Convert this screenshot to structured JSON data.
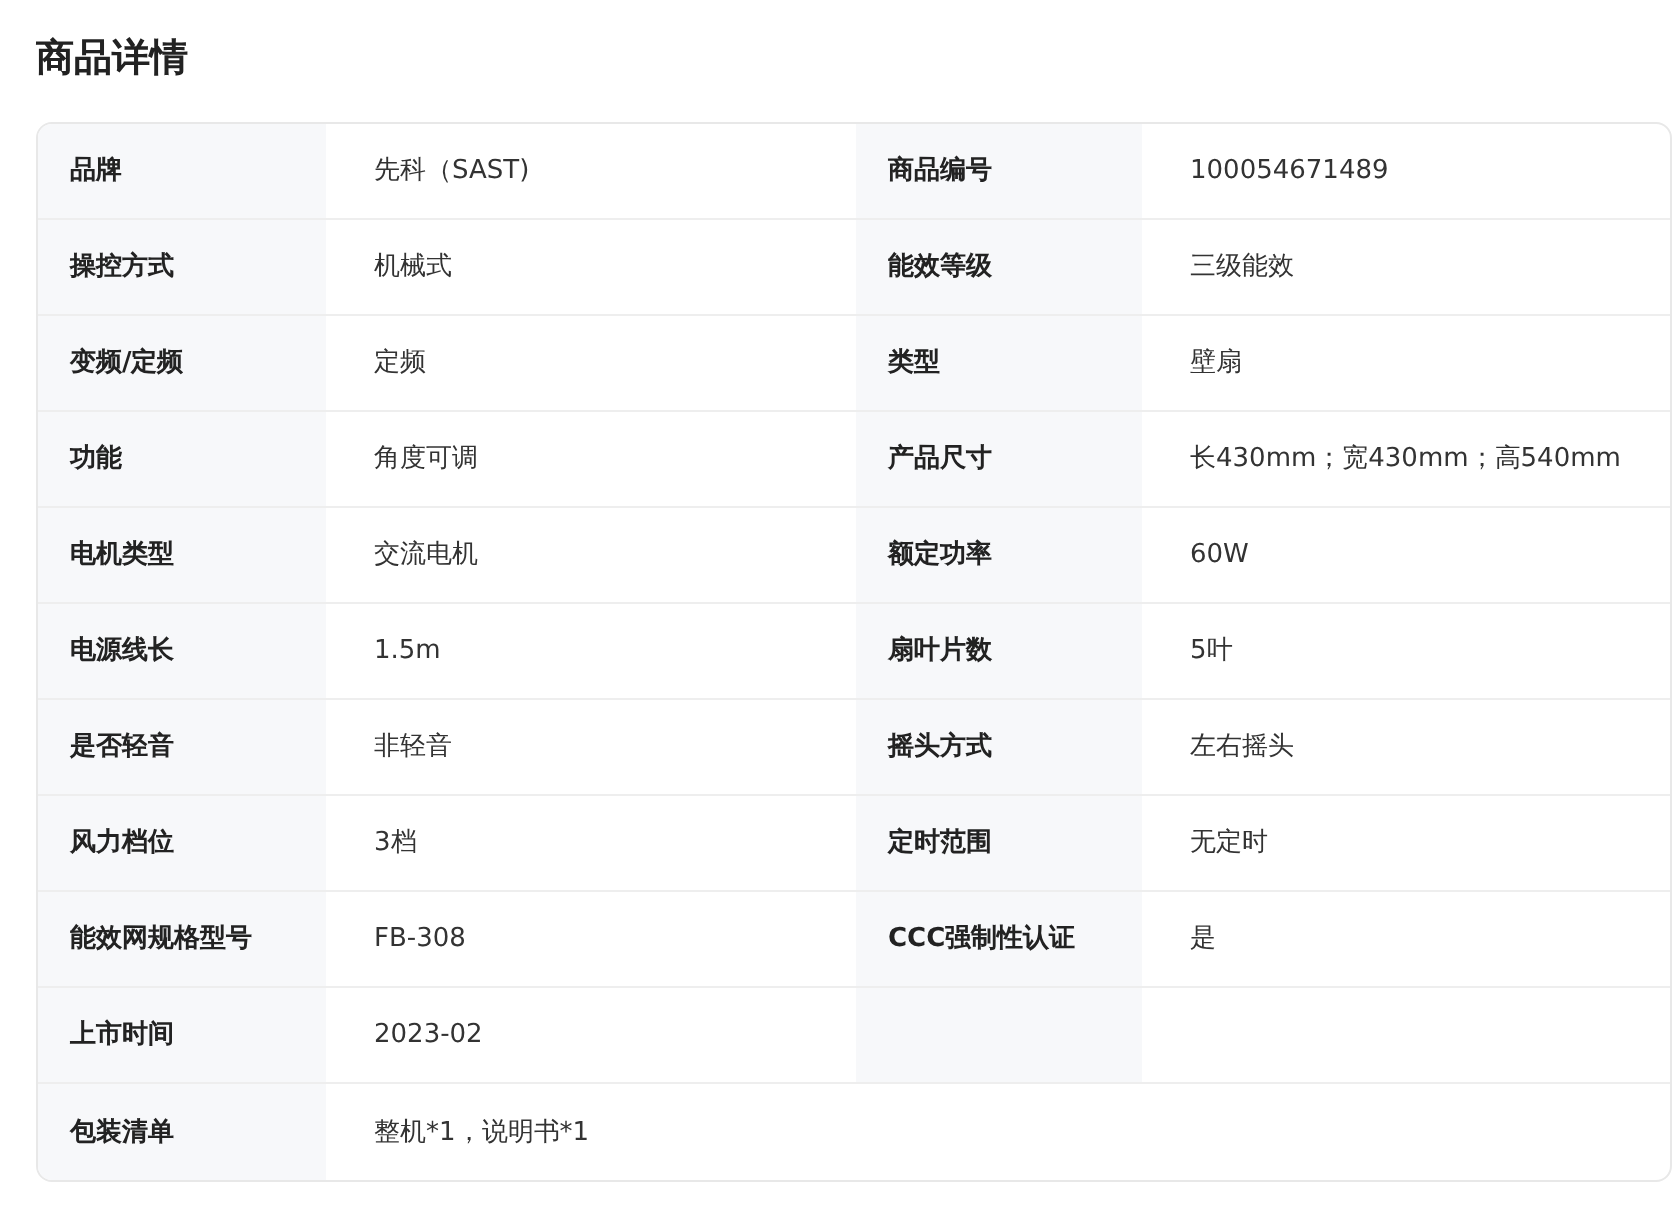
{
  "title": "商品详情",
  "rows": [
    {
      "kind": "pair",
      "fields": [
        {
          "label": "品牌",
          "value": "先科（SAST)"
        },
        {
          "label": "商品编号",
          "value": "100054671489"
        }
      ]
    },
    {
      "kind": "pair",
      "fields": [
        {
          "label": "操控方式",
          "value": "机械式"
        },
        {
          "label": "能效等级",
          "value": "三级能效"
        }
      ]
    },
    {
      "kind": "pair",
      "fields": [
        {
          "label": "变频/定频",
          "value": "定频"
        },
        {
          "label": "类型",
          "value": "壁扇"
        }
      ]
    },
    {
      "kind": "pair",
      "fields": [
        {
          "label": "功能",
          "value": "角度可调"
        },
        {
          "label": "产品尺寸",
          "value": "长430mm；宽430mm；高540mm"
        }
      ]
    },
    {
      "kind": "pair",
      "fields": [
        {
          "label": "电机类型",
          "value": "交流电机"
        },
        {
          "label": "额定功率",
          "value": "60W"
        }
      ]
    },
    {
      "kind": "pair",
      "fields": [
        {
          "label": "电源线长",
          "value": "1.5m"
        },
        {
          "label": "扇叶片数",
          "value": "5叶"
        }
      ]
    },
    {
      "kind": "pair",
      "fields": [
        {
          "label": "是否轻音",
          "value": "非轻音"
        },
        {
          "label": "摇头方式",
          "value": "左右摇头"
        }
      ]
    },
    {
      "kind": "pair",
      "fields": [
        {
          "label": "风力档位",
          "value": "3档"
        },
        {
          "label": "定时范围",
          "value": "无定时"
        }
      ]
    },
    {
      "kind": "pair",
      "fields": [
        {
          "label": "能效网规格型号",
          "value": "FB-308"
        },
        {
          "label": "CCC强制性认证",
          "value": "是"
        }
      ]
    },
    {
      "kind": "pair",
      "fields": [
        {
          "label": "上市时间",
          "value": "2023-02"
        }
      ]
    },
    {
      "kind": "wide",
      "fields": [
        {
          "label": "包装清单",
          "value": "整机*1，说明书*1"
        }
      ]
    }
  ]
}
